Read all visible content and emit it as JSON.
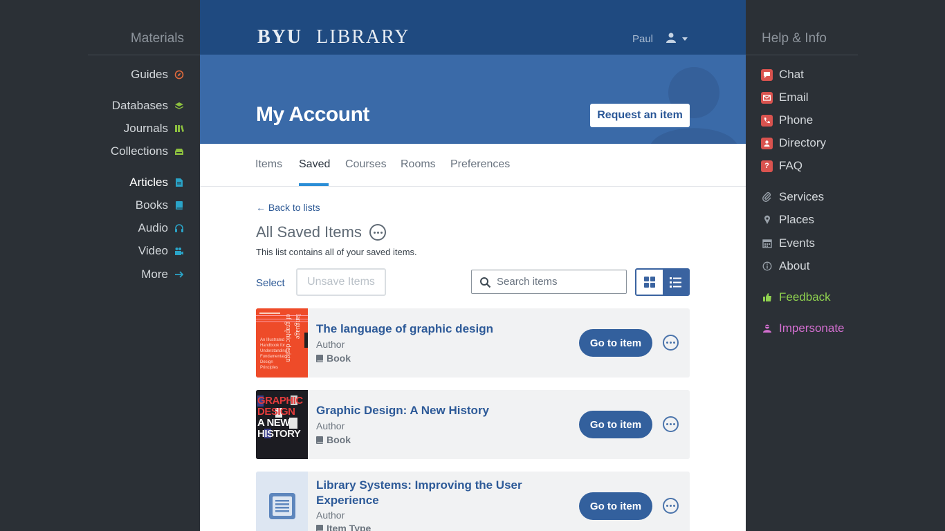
{
  "left_sidebar": {
    "title": "Materials",
    "items": [
      {
        "label": "Guides",
        "icon": "compass-icon",
        "color": "#e36b3d"
      },
      {
        "label": "Databases",
        "icon": "layers-icon",
        "color": "#8cbf3f"
      },
      {
        "label": "Journals",
        "icon": "journals-icon",
        "color": "#8cbf3f"
      },
      {
        "label": "Collections",
        "icon": "archive-icon",
        "color": "#8cbf3f"
      },
      {
        "label": "Articles",
        "icon": "article-icon",
        "color": "#2aa4c8"
      },
      {
        "label": "Books",
        "icon": "book-icon",
        "color": "#2aa4c8"
      },
      {
        "label": "Audio",
        "icon": "headphones-icon",
        "color": "#2aa4c8"
      },
      {
        "label": "Video",
        "icon": "video-icon",
        "color": "#2aa4c8"
      },
      {
        "label": "More",
        "icon": "arrow-right-icon",
        "color": "#2aa4c8"
      }
    ]
  },
  "right_sidebar": {
    "title": "Help & Info",
    "items": [
      {
        "label": "Chat",
        "icon": "chat-icon",
        "color": "#d9534f"
      },
      {
        "label": "Email",
        "icon": "email-icon",
        "color": "#d9534f"
      },
      {
        "label": "Phone",
        "icon": "phone-icon",
        "color": "#d9534f"
      },
      {
        "label": "Directory",
        "icon": "directory-icon",
        "color": "#d9534f"
      },
      {
        "label": "FAQ",
        "icon": "question-icon",
        "color": "#d9534f"
      },
      {
        "label": "Services",
        "icon": "paperclip-icon",
        "color": "#9aa2ab"
      },
      {
        "label": "Places",
        "icon": "map-pin-icon",
        "color": "#9aa2ab"
      },
      {
        "label": "Events",
        "icon": "calendar-icon",
        "color": "#9aa2ab"
      },
      {
        "label": "About",
        "icon": "info-icon",
        "color": "#9aa2ab"
      },
      {
        "label": "Feedback",
        "icon": "thumbs-up-icon",
        "color": "#8fd14f"
      },
      {
        "label": "Impersonate",
        "icon": "impersonate-icon",
        "color": "#d46fd1"
      }
    ]
  },
  "header": {
    "logo_part1": "BYU",
    "logo_part2": "LIBRARY",
    "user_name": "Paul"
  },
  "hero": {
    "title": "My Account",
    "request_button": "Request an item"
  },
  "tabs": [
    {
      "label": "Items",
      "active": false
    },
    {
      "label": "Saved",
      "active": true
    },
    {
      "label": "Courses",
      "active": false
    },
    {
      "label": "Rooms",
      "active": false
    },
    {
      "label": "Preferences",
      "active": false
    }
  ],
  "list": {
    "back_link": "← Back to lists",
    "title": "All Saved Items",
    "description": "This list contains all of your saved items.",
    "select_label": "Select",
    "unsave_label": "Unsave Items",
    "search_placeholder": "Search items"
  },
  "items": [
    {
      "title": "The language of graphic design",
      "author": "Author",
      "type": "Book",
      "button": "Go to item",
      "thumb": "cover-language-graphic-design"
    },
    {
      "title": "Graphic Design: A New History",
      "author": "Author",
      "type": "Book",
      "button": "Go to item",
      "thumb": "cover-graphic-design-history"
    },
    {
      "title": "Library Systems: Improving the User Experience",
      "author": "Author",
      "type": "Item Type",
      "button": "Go to item",
      "thumb": "document-icon"
    }
  ],
  "covers": {
    "cover1_small": "An Illustrated Handbook for Understanding Fundamental Design Principles",
    "cover1_title1": "language",
    "cover1_title2": "of graphic design",
    "cover2_lines": [
      "GRAPHIC",
      "DESIGN",
      "A NEW",
      "HISTORY"
    ]
  },
  "colors": {
    "brand_dark": "#1f4a80",
    "brand_mid": "#3a6aa8",
    "link": "#2e5a96",
    "accent_tab": "#2b8ed6"
  }
}
